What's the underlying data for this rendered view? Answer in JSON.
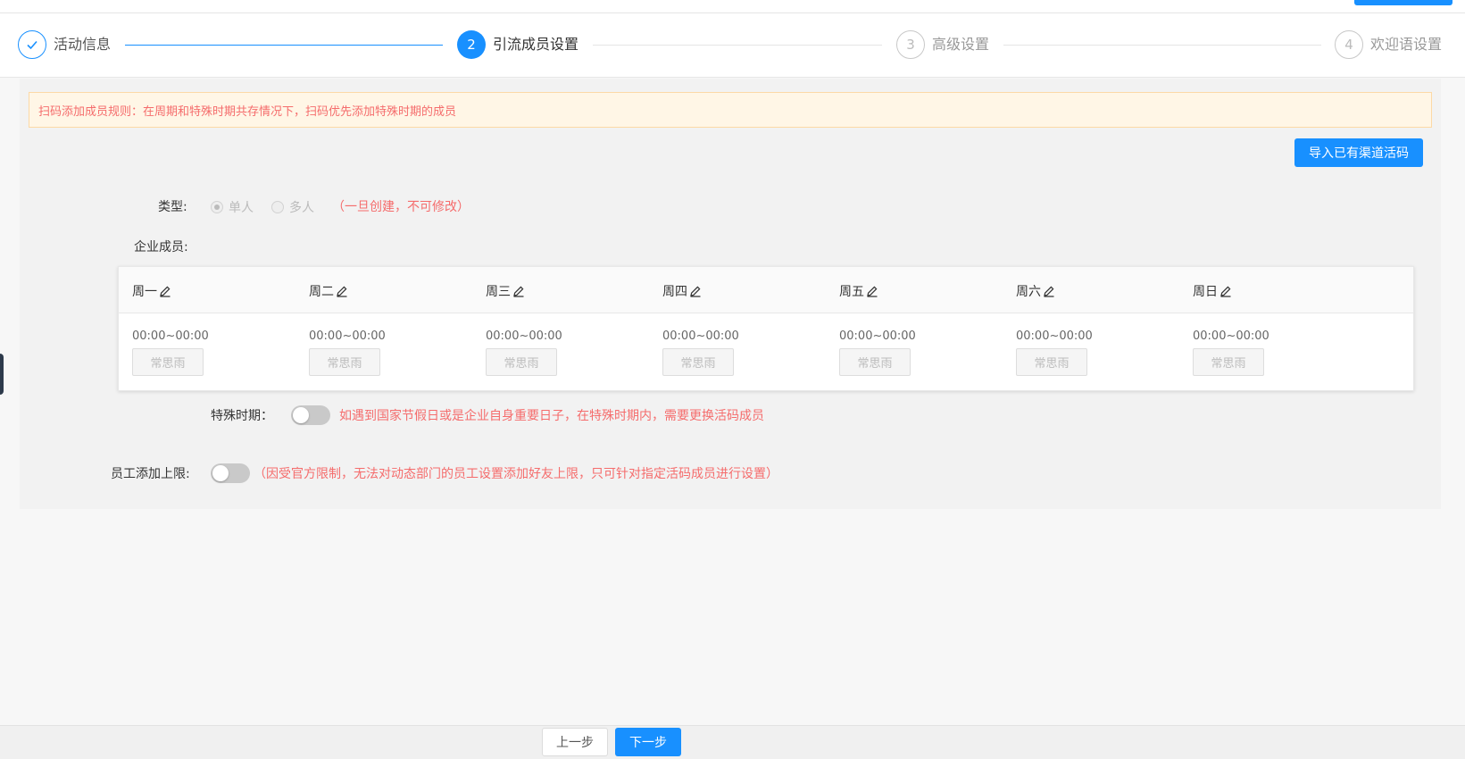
{
  "steps": [
    {
      "index": "✓",
      "title": "活动信息",
      "state": "done"
    },
    {
      "index": "2",
      "title": "引流成员设置",
      "state": "active"
    },
    {
      "index": "3",
      "title": "高级设置",
      "state": "wait"
    },
    {
      "index": "4",
      "title": "欢迎语设置",
      "state": "wait"
    }
  ],
  "alert": {
    "text": "扫码添加成员规则：在周期和特殊时期共存情况下，扫码优先添加特殊时期的成员"
  },
  "import_button": {
    "label": "导入已有渠道活码"
  },
  "type_field": {
    "label": "类型:",
    "options": [
      {
        "label": "单人",
        "checked": true
      },
      {
        "label": "多人",
        "checked": false
      }
    ],
    "note": "（一旦创建，不可修改）"
  },
  "members_field": {
    "label": "企业成员:"
  },
  "schedule": {
    "days": [
      {
        "name": "周一",
        "time": "00:00~00:00",
        "member": "常思雨"
      },
      {
        "name": "周二",
        "time": "00:00~00:00",
        "member": "常思雨"
      },
      {
        "name": "周三",
        "time": "00:00~00:00",
        "member": "常思雨"
      },
      {
        "name": "周四",
        "time": "00:00~00:00",
        "member": "常思雨"
      },
      {
        "name": "周五",
        "time": "00:00~00:00",
        "member": "常思雨"
      },
      {
        "name": "周六",
        "time": "00:00~00:00",
        "member": "常思雨"
      },
      {
        "name": "周日",
        "time": "00:00~00:00",
        "member": "常思雨"
      }
    ]
  },
  "special_period": {
    "label": "特殊时期：",
    "enabled": false,
    "note": "如遇到国家节假日或是企业自身重要日子，在特殊时期内，需要更换活码成员"
  },
  "add_limit": {
    "label": "员工添加上限:",
    "enabled": false,
    "note": "（因受官方限制，无法对动态部门的员工设置添加好友上限，只可针对指定活码成员进行设置）"
  },
  "footer": {
    "prev_label": "上一步",
    "next_label": "下一步"
  },
  "colors": {
    "primary": "#1890ff",
    "warning_text": "#f56c6c",
    "alert_bg": "#fff6e6"
  }
}
